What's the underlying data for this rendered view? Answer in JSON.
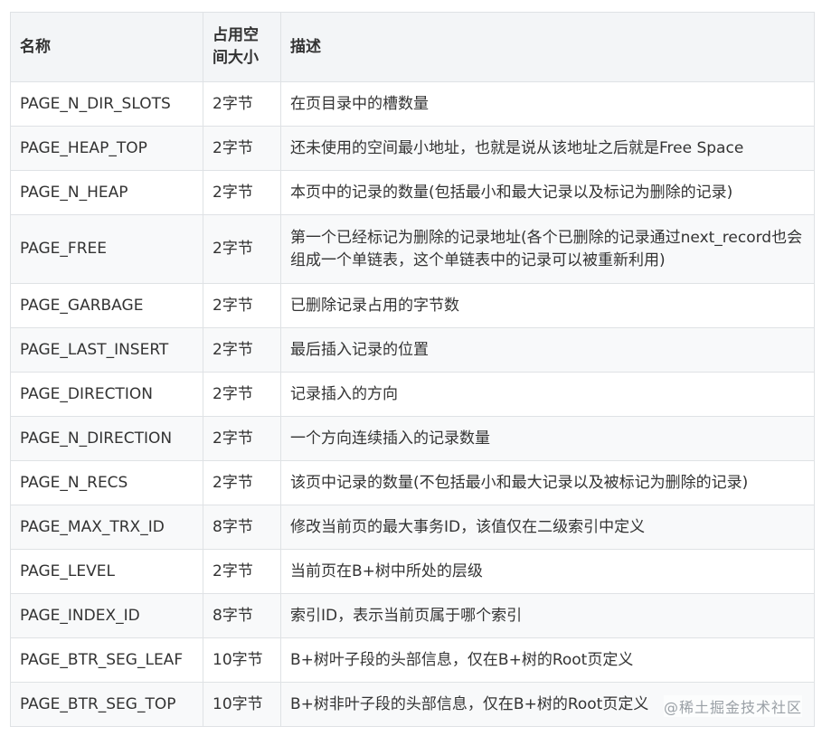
{
  "table": {
    "headers": [
      "名称",
      "占用空间大小",
      "描述"
    ],
    "rows": [
      {
        "name": "PAGE_N_DIR_SLOTS",
        "size": "2字节",
        "desc": "在页目录中的槽数量"
      },
      {
        "name": "PAGE_HEAP_TOP",
        "size": "2字节",
        "desc": "还未使用的空间最小地址，也就是说从该地址之后就是Free Space"
      },
      {
        "name": "PAGE_N_HEAP",
        "size": "2字节",
        "desc": "本页中的记录的数量(包括最小和最大记录以及标记为删除的记录)"
      },
      {
        "name": "PAGE_FREE",
        "size": "2字节",
        "desc": "第一个已经标记为删除的记录地址(各个已删除的记录通过next_record也会组成一个单链表，这个单链表中的记录可以被重新利用)"
      },
      {
        "name": "PAGE_GARBAGE",
        "size": "2字节",
        "desc": "已删除记录占用的字节数"
      },
      {
        "name": "PAGE_LAST_INSERT",
        "size": "2字节",
        "desc": "最后插入记录的位置"
      },
      {
        "name": "PAGE_DIRECTION",
        "size": "2字节",
        "desc": "记录插入的方向"
      },
      {
        "name": "PAGE_N_DIRECTION",
        "size": "2字节",
        "desc": "一个方向连续插入的记录数量"
      },
      {
        "name": "PAGE_N_RECS",
        "size": "2字节",
        "desc": "该页中记录的数量(不包括最小和最大记录以及被标记为删除的记录)"
      },
      {
        "name": "PAGE_MAX_TRX_ID",
        "size": "8字节",
        "desc": "修改当前页的最大事务ID，该值仅在二级索引中定义"
      },
      {
        "name": "PAGE_LEVEL",
        "size": "2字节",
        "desc": "当前页在B+树中所处的层级"
      },
      {
        "name": "PAGE_INDEX_ID",
        "size": "8字节",
        "desc": "索引ID，表示当前页属于哪个索引"
      },
      {
        "name": "PAGE_BTR_SEG_LEAF",
        "size": "10字节",
        "desc": "B+树叶子段的头部信息，仅在B+树的Root页定义"
      },
      {
        "name": "PAGE_BTR_SEG_TOP",
        "size": "10字节",
        "desc": "B+树非叶子段的头部信息，仅在B+树的Root页定义"
      }
    ]
  },
  "watermark": "@稀土掘金技术社区"
}
